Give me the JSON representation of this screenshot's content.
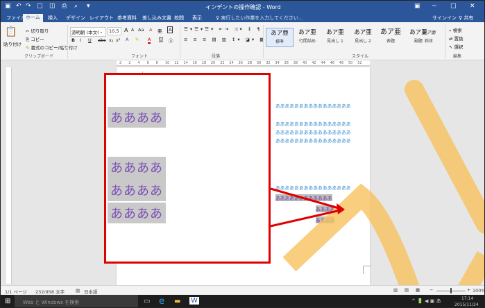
{
  "titlebar": {
    "title": "インデントの操作確認 - Word",
    "min": "─",
    "max": "□",
    "close": "✕",
    "account_icon": "▣"
  },
  "tabs": {
    "items": [
      "ファイル",
      "ホーム",
      "挿入",
      "デザイン",
      "レイアウト",
      "参考資料",
      "差し込み文書",
      "校閲",
      "表示"
    ],
    "active": "ホーム",
    "tell": "♀ 実行したい作業を入力してください...",
    "signin": "サインイン",
    "share": "♀ 共有"
  },
  "ribbon": {
    "clipboard": {
      "paste": "貼り付け",
      "cut": "切り取り",
      "copy": "コピー",
      "format_painter": "書式のコピー/貼り付け",
      "label": "クリップボード"
    },
    "font": {
      "name": "游明朝 (本文(・",
      "size": "10.5",
      "grow": "A",
      "shrink": "A",
      "case": "Aa",
      "clear": "A",
      "kana": "亜",
      "box": "A",
      "bold": "B",
      "italic": "I",
      "underline": "U",
      "strike": "abc",
      "sub": "x₂",
      "sup": "x²",
      "label": "フォント"
    },
    "paragraph": {
      "label": "段落"
    },
    "styles": {
      "items": [
        {
          "sample": "あア亜",
          "name": "標準"
        },
        {
          "sample": "あア亜",
          "name": "行間詰め"
        },
        {
          "sample": "あア亜",
          "name": "見出し 1"
        },
        {
          "sample": "あア亜",
          "name": "見出し 2"
        },
        {
          "sample": "あア亜",
          "name": "表題"
        },
        {
          "sample": "あア亜",
          "name": "副題"
        },
        {
          "sample": "あア亜",
          "name": "斜体"
        }
      ],
      "label": "スタイル"
    },
    "editing": {
      "find": "検索",
      "replace": "置換",
      "select": "選択",
      "label": "編集"
    }
  },
  "ruler": {
    "ticks": [
      "2",
      "2",
      "4",
      "6",
      "8",
      "10",
      "12",
      "14",
      "16",
      "18",
      "20",
      "22",
      "24",
      "26",
      "28",
      "30",
      "32",
      "34",
      "36",
      "38",
      "40",
      "42",
      "44",
      "46",
      "48",
      "50",
      "52"
    ]
  },
  "doc": {
    "lines": [
      "ああああああああああああああああ",
      "ああああああああああああああああ",
      "ああああああああああああああああ",
      "ああああああああああああああああ",
      "ああああああああああああああああ"
    ],
    "selected_lines": [
      "ああああああああああああ",
      "ああああ",
      "ああああ"
    ]
  },
  "zoom": {
    "lines": [
      "ああああ",
      "ああああ",
      "ああああ",
      "ああああ"
    ]
  },
  "status": {
    "page": "1/1 ページ",
    "words": "232/958 文字",
    "lang": "日本語",
    "zoom": "100%"
  },
  "taskbar": {
    "search": "Web と Windows を検索",
    "time": "17:14",
    "date": "2015/11/24"
  },
  "colors": {
    "accent": "#2b579a",
    "arrow": "#e00000",
    "highlight": "#f7c35f",
    "selected_text": "#6b3fa0",
    "doc_text": "#3b8fd0"
  }
}
